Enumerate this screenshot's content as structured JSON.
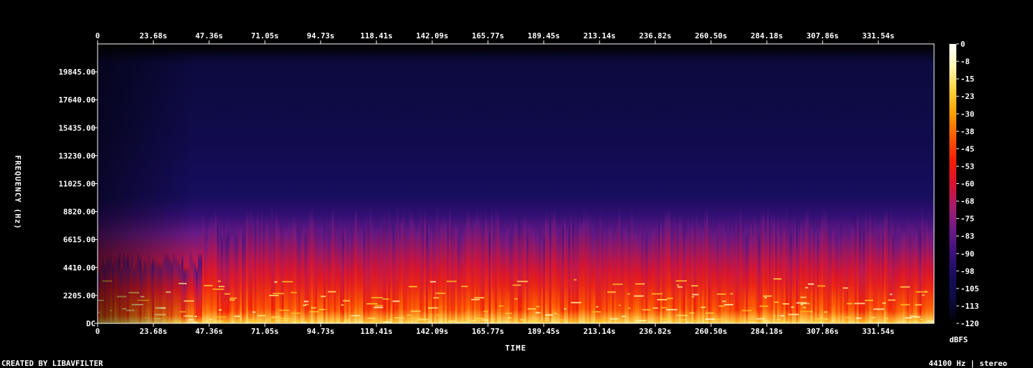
{
  "chart_data": {
    "type": "heatmap",
    "title": "",
    "xlabel": "TIME",
    "ylabel": "FREQUENCY (Hz)",
    "x_tick_labels": [
      "0",
      "23.68s",
      "47.36s",
      "71.05s",
      "94.73s",
      "118.41s",
      "142.09s",
      "165.77s",
      "189.45s",
      "213.14s",
      "236.82s",
      "260.50s",
      "284.18s",
      "307.86s",
      "331.54s"
    ],
    "x_tick_values_s": [
      0,
      23.68,
      47.36,
      71.05,
      94.73,
      118.41,
      142.09,
      165.77,
      189.45,
      213.14,
      236.82,
      260.5,
      284.18,
      307.86,
      331.54
    ],
    "xlim": [
      0,
      355.2
    ],
    "y_tick_labels": [
      "DC",
      "2205.00",
      "4410.00",
      "6615.00",
      "8820.00",
      "11025.00",
      "13230.00",
      "15435.00",
      "17640.00",
      "19845.00"
    ],
    "y_tick_values_hz": [
      0,
      2205,
      4410,
      6615,
      8820,
      11025,
      13230,
      15435,
      17640,
      19845
    ],
    "ylim": [
      0,
      22050
    ],
    "colorbar": {
      "label": "dBFS",
      "tick_labels": [
        "0",
        "-8",
        "-15",
        "-23",
        "-30",
        "-38",
        "-45",
        "-53",
        "-60",
        "-68",
        "-75",
        "-83",
        "-90",
        "-98",
        "-105",
        "-113",
        "-120"
      ],
      "range": [
        -120,
        0
      ],
      "colormap": [
        "#000000",
        "#0c0a3e",
        "#170d5e",
        "#3a0f7a",
        "#6b1a86",
        "#a41c6e",
        "#d8122e",
        "#f21d05",
        "#ff5a00",
        "#ff9e00",
        "#ffd23a",
        "#fff6b0",
        "#ffffff"
      ]
    },
    "energy_profile": {
      "description_level": "approximate",
      "freq_hz": [
        0,
        500,
        1500,
        3000,
        5000,
        7000,
        8500,
        10000,
        15000,
        20500,
        22050
      ],
      "level_dbfs": [
        -12,
        -20,
        -38,
        -52,
        -66,
        -80,
        -92,
        -100,
        -106,
        -110,
        -120
      ]
    }
  },
  "footer": {
    "left": "CREATED BY LIBAVFILTER",
    "right": "44100 Hz | stereo"
  }
}
